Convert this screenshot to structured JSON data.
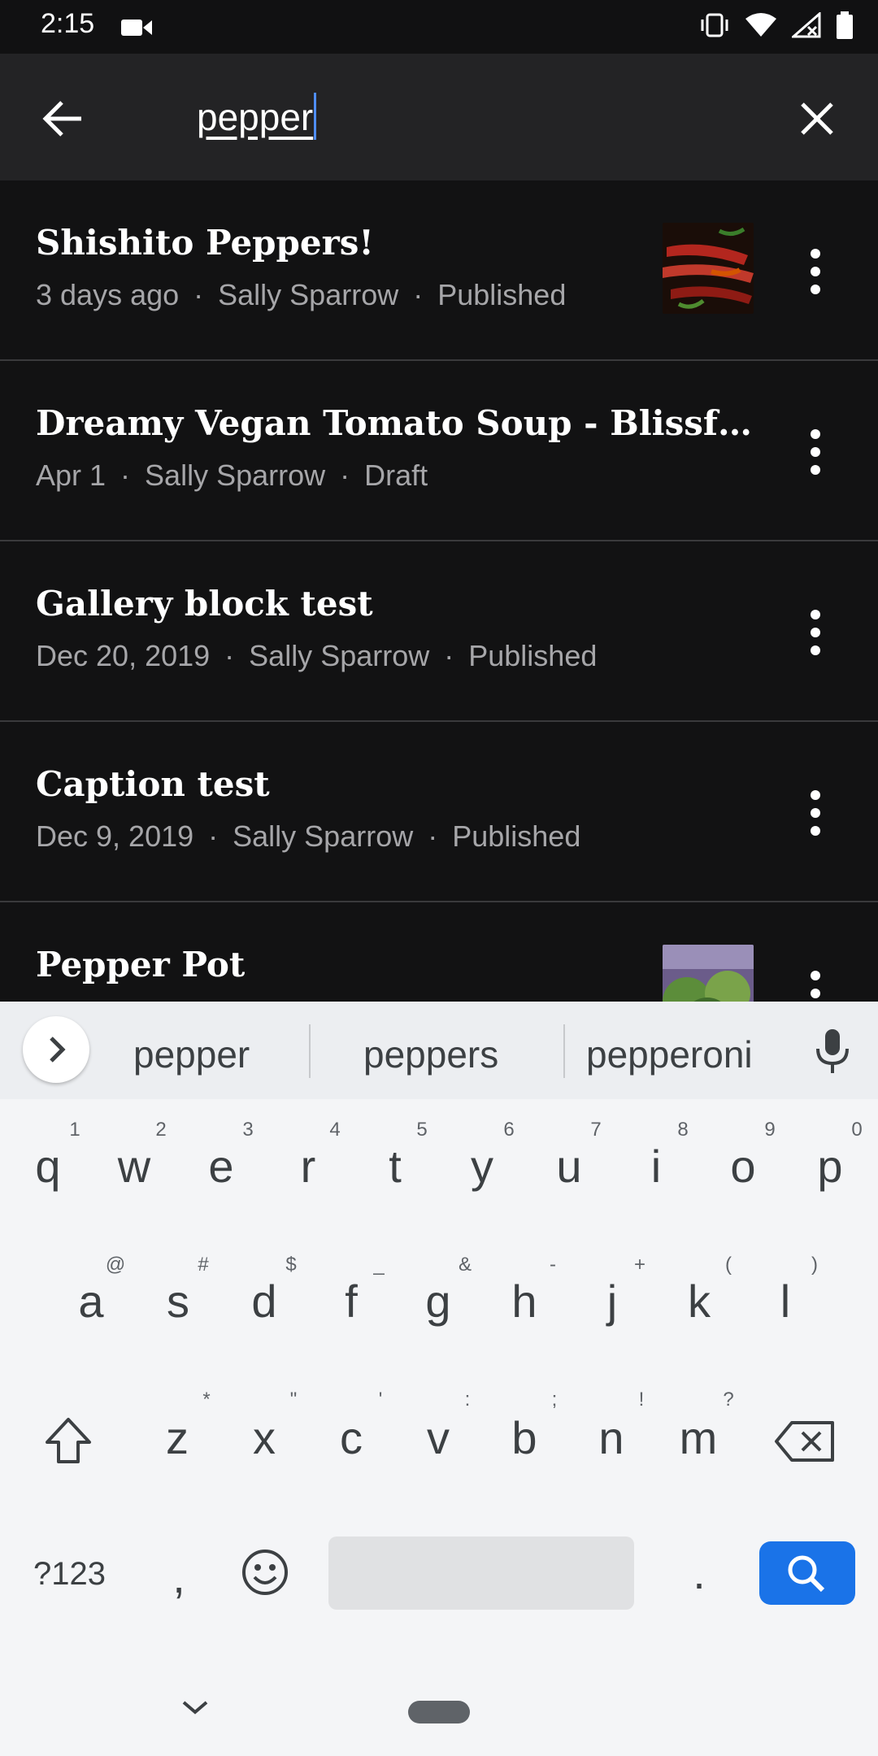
{
  "status_bar": {
    "time": "2:15"
  },
  "search": {
    "query": "pepper"
  },
  "posts": [
    {
      "title": "Shishito Peppers!",
      "date": "3 days ago",
      "author": "Sally Sparrow",
      "status": "Published",
      "has_thumbnail": true
    },
    {
      "title": "Dreamy Vegan Tomato Soup - Blissful B...",
      "date": "Apr 1",
      "author": "Sally Sparrow",
      "status": "Draft",
      "has_thumbnail": false
    },
    {
      "title": "Gallery block test",
      "date": "Dec 20, 2019",
      "author": "Sally Sparrow",
      "status": "Published",
      "has_thumbnail": false
    },
    {
      "title": "Caption test",
      "date": "Dec 9, 2019",
      "author": "Sally Sparrow",
      "status": "Published",
      "has_thumbnail": false
    },
    {
      "title": "Pepper Pot",
      "date": "",
      "author": "",
      "status": "",
      "has_thumbnail": true
    }
  ],
  "meta_separator": "·",
  "keyboard": {
    "suggestions": [
      "pepper",
      "peppers",
      "pepperoni"
    ],
    "row1": [
      "q",
      "w",
      "e",
      "r",
      "t",
      "y",
      "u",
      "i",
      "o",
      "p"
    ],
    "row1_hints": [
      "1",
      "2",
      "3",
      "4",
      "5",
      "6",
      "7",
      "8",
      "9",
      "0"
    ],
    "row2": [
      "a",
      "s",
      "d",
      "f",
      "g",
      "h",
      "j",
      "k",
      "l"
    ],
    "row2_hints": [
      "@",
      "#",
      "$",
      "_",
      "&",
      "-",
      "+",
      "(",
      ")"
    ],
    "row3": [
      "z",
      "x",
      "c",
      "v",
      "b",
      "n",
      "m"
    ],
    "row3_hints": [
      "*",
      "\"",
      "'",
      ":",
      ";",
      "!",
      "?"
    ],
    "symbols_label": "?123",
    "comma": ",",
    "period": "."
  },
  "colors": {
    "accent": "#1a73e8",
    "background": "#121213",
    "toolbar": "#232325"
  }
}
